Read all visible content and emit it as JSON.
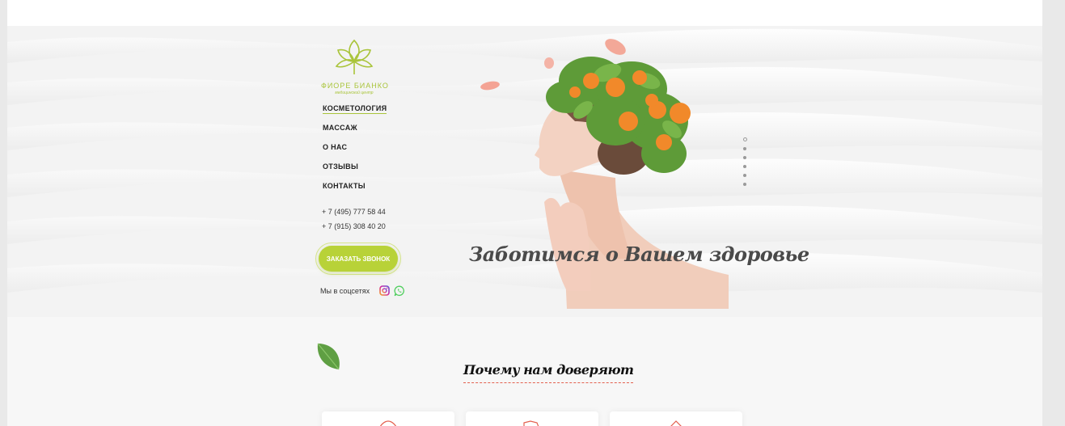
{
  "brand": {
    "name": "ФИОРЕ БИАНКО",
    "tagline": "медицинский центр",
    "accent_color": "#b8d238",
    "logo_icon": "flower-logo-icon"
  },
  "nav": {
    "items": [
      {
        "label": "КОСМЕТОЛОГИЯ",
        "active": true
      },
      {
        "label": "МАССАЖ",
        "active": false
      },
      {
        "label": "О НАС",
        "active": false
      },
      {
        "label": "ОТЗЫВЫ",
        "active": false
      },
      {
        "label": "КОНТАКТЫ",
        "active": false
      }
    ]
  },
  "contacts": {
    "phone_1": "+ 7 (495) 777 58 44",
    "phone_2": "+ 7 (915) 308 40 20"
  },
  "cta": {
    "label": "ЗАКАЗАТЬ ЗВОНОК"
  },
  "social": {
    "label": "Мы в соцсетях",
    "icons": [
      "instagram-icon",
      "whatsapp-icon"
    ]
  },
  "hero": {
    "slogan": "Заботимся о Вашем здоровье",
    "slide_count": 6,
    "active_slide": 1
  },
  "why_section": {
    "title": "Почему нам доверяют",
    "underline_color": "#e3604f",
    "cards_count": 3
  }
}
